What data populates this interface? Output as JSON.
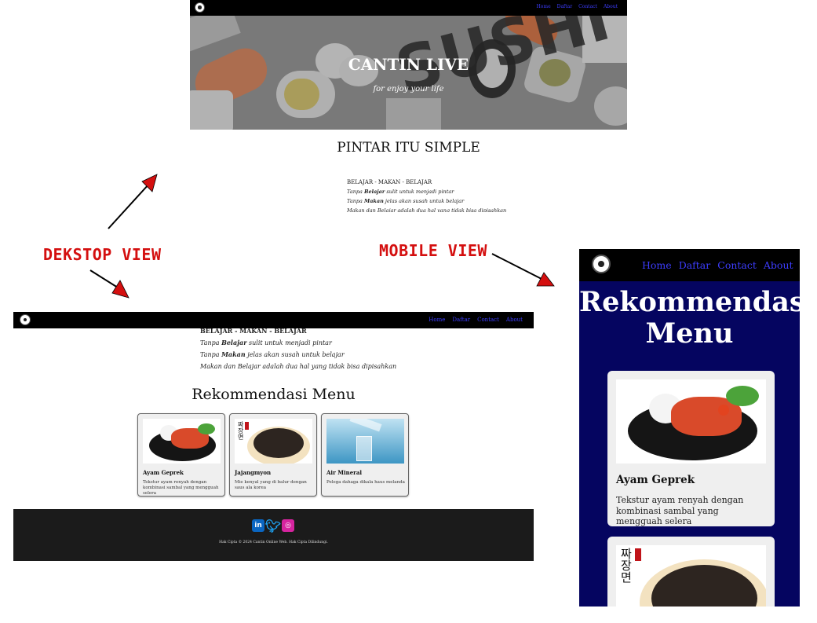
{
  "nav": {
    "links": [
      "Home",
      "Daftar",
      "Contact",
      "About"
    ]
  },
  "hero": {
    "title": "CANTIN LIVE",
    "subtitle": "for enjoy your life",
    "bg_text": "SUSHI"
  },
  "section1": {
    "heading": "PINTAR ITU SIMPLE",
    "line0": "BELAJAR - MAKAN - BELAJAR",
    "line1_pre": "Tanpa ",
    "line1_b": "Belajar",
    "line1_post": " sulit untuk menjadi pintar",
    "line2_pre": "Tanpa ",
    "line2_b": "Makan",
    "line2_post": " jelas akan susah untuk belajar",
    "line3": "Makan dan Belajar adalah dua hal yang tidak bisa dipisahkan"
  },
  "section2": {
    "clipped_line": "BELAJAR - MAKAN - BELAJAR",
    "heading": "Rekommendasi Menu"
  },
  "menu": [
    {
      "name": "Ayam Geprek",
      "desc": "Tekstur ayam renyah dengan kombinasi sambal yang mengguah selera"
    },
    {
      "name": "Jajangmyon",
      "desc": "Mie kenyal yang di balur dengan saus ala korea"
    },
    {
      "name": "Air Mineral",
      "desc": "Pelega dahaga dikala haus melanda"
    }
  ],
  "footer": {
    "socials": [
      "linkedin-icon",
      "twitter-icon",
      "instagram-icon"
    ],
    "copyright": "Hak Cipta © 2024 Cantin Online Web. Hak Cipta Dilindungi."
  },
  "mobile": {
    "heading": "Rekommendasi Menu"
  },
  "annotations": {
    "desktop": "DEKSTOP VIEW",
    "mobile": "MOBILE VIEW"
  },
  "colors": {
    "nav_bg": "#000000",
    "nav_link": "#3d3dff",
    "mobile_bg": "#050560",
    "annotation": "#d40f0f",
    "footer_bg": "#1b1b1b"
  }
}
